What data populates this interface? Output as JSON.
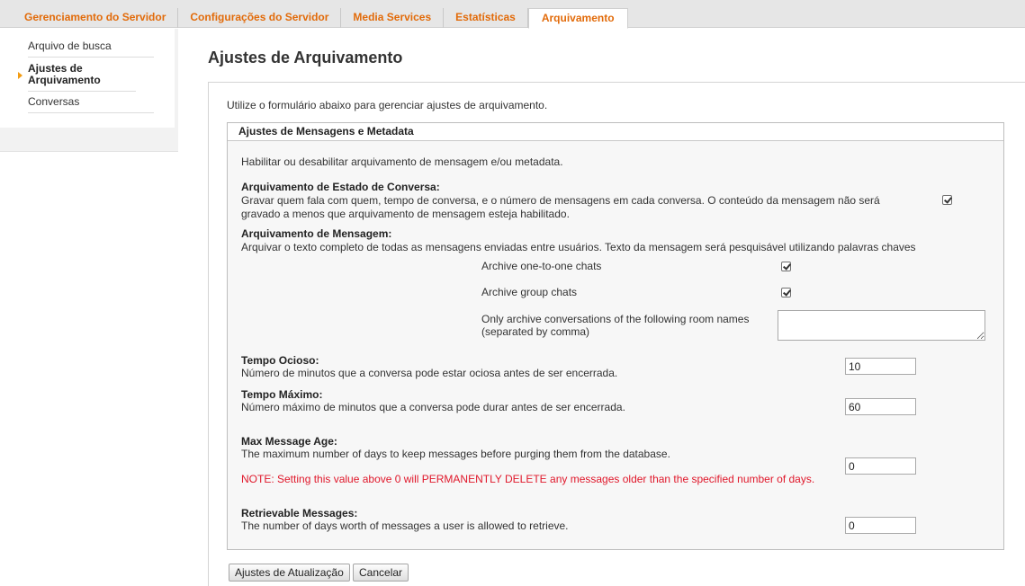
{
  "tabs": [
    {
      "label": "Gerenciamento do Servidor"
    },
    {
      "label": "Configurações do Servidor"
    },
    {
      "label": "Media Services"
    },
    {
      "label": "Estatísticas"
    },
    {
      "label": "Arquivamento"
    }
  ],
  "sidebar": {
    "items": [
      {
        "label": "Arquivo de busca"
      },
      {
        "label": "Ajustes de Arquivamento"
      },
      {
        "label": "Conversas"
      }
    ]
  },
  "page": {
    "title": "Ajustes de Arquivamento",
    "intro": "Utilize o formulário abaixo para gerenciar ajustes de arquivamento."
  },
  "section": {
    "header": "Ajustes de Mensagens e Metadata",
    "description": "Habilitar ou desabilitar arquivamento de mensagem e/ou metadata.",
    "state_archiving": {
      "label": "Arquivamento de Estado de Conversa:",
      "text_line1": "Gravar quem fala com quem, tempo de conversa, e o número de mensagens em cada conversa. O conteúdo da mensagem não será",
      "text_line2": "gravado a menos que arquivamento de mensagem esteja habilitado.",
      "checked": true
    },
    "message_archiving": {
      "label": "Arquivamento de Mensagem:",
      "text": "Arquivar o texto completo de todas as mensagens enviadas entre usuários. Texto da mensagem será pesquisável utilizando palavras chaves",
      "one_to_one": {
        "label": "Archive one-to-one chats",
        "checked": true
      },
      "group": {
        "label": "Archive group chats",
        "checked": true
      },
      "rooms": {
        "label_line1": "Only archive conversations of the following room names",
        "label_line2": "(separated by comma)",
        "value": ""
      }
    },
    "idle_time": {
      "label": "Tempo Ocioso:",
      "text": "Número de minutos que a conversa pode estar ociosa antes de ser encerrada.",
      "value": "10"
    },
    "max_time": {
      "label": "Tempo Máximo:",
      "text": "Número máximo de minutos que a conversa pode durar antes de ser encerrada.",
      "value": "60"
    },
    "max_age": {
      "label": "Max Message Age:",
      "text": "The maximum number of days to keep messages before purging them from the database.",
      "note": "NOTE: Setting this value above 0 will PERMANENTLY DELETE any messages older than the specified number of days.",
      "value": "0"
    },
    "retrievable": {
      "label": "Retrievable Messages:",
      "text": "The number of days worth of messages a user is allowed to retrieve.",
      "value": "0"
    }
  },
  "buttons": {
    "update": "Ajustes de Atualização",
    "cancel": "Cancelar"
  },
  "colors": {
    "tab_text": "#e26b0a",
    "note": "#e0182b",
    "sidebar_arrow": "#f39c12"
  }
}
